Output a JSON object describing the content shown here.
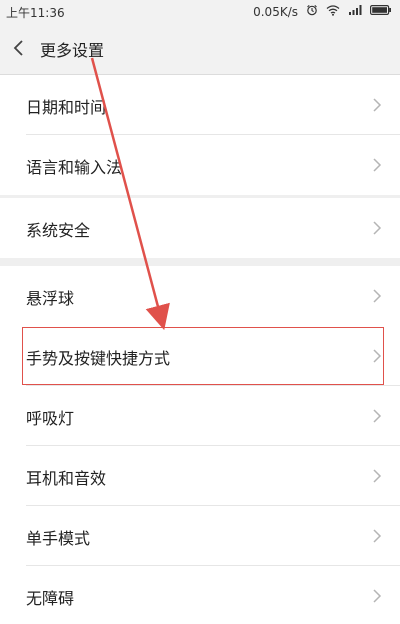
{
  "status_bar": {
    "time": "上午11:36",
    "speed": "0.05K/s",
    "icons": [
      "alarm-icon",
      "wifi-icon",
      "signal-icon",
      "battery-icon"
    ]
  },
  "header": {
    "back_icon": "chevron-left-icon",
    "title": "更多设置"
  },
  "groups": [
    {
      "items": [
        {
          "label": "日期和时间"
        },
        {
          "label": "语言和输入法"
        }
      ]
    },
    {
      "items": [
        {
          "label": "系统安全"
        }
      ]
    },
    {
      "items": [
        {
          "label": "悬浮球"
        },
        {
          "label": "手势及按键快捷方式",
          "highlighted": true
        },
        {
          "label": "呼吸灯"
        },
        {
          "label": "耳机和音效"
        },
        {
          "label": "单手模式"
        },
        {
          "label": "无障碍"
        }
      ]
    }
  ],
  "colors": {
    "background": "#efefef",
    "row_background": "#ffffff",
    "annotation_red": "#e0514b"
  }
}
